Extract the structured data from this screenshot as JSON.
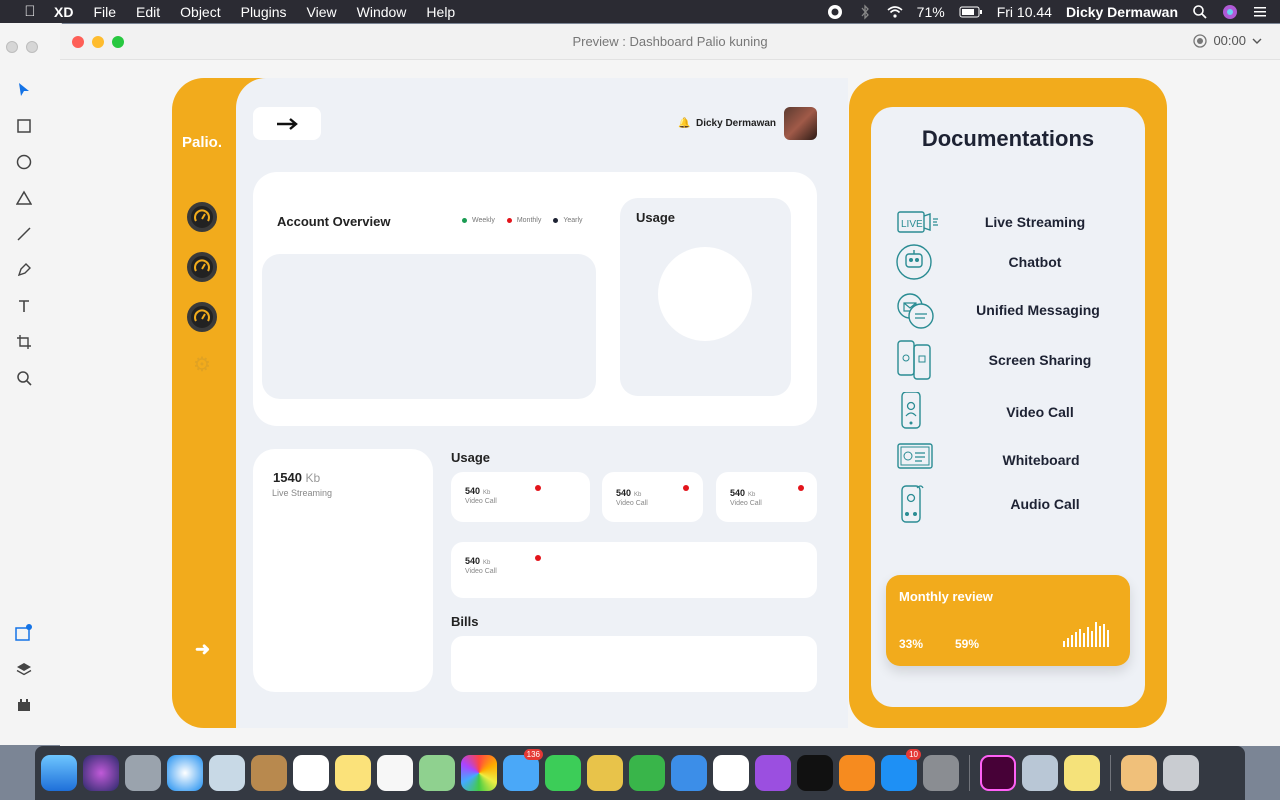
{
  "menubar": {
    "app_name": "XD",
    "menus": [
      "File",
      "Edit",
      "Object",
      "Plugins",
      "View",
      "Window",
      "Help"
    ],
    "battery": "71%",
    "clock": "Fri 10.44",
    "user": "Dicky Dermawan"
  },
  "window": {
    "title": "Preview : Dashboard Palio kuning",
    "timer": "00:00"
  },
  "dashboard": {
    "logo": "Palio.",
    "user_name": "Dicky Dermawan",
    "overview": {
      "title": "Account Overview",
      "legend": [
        {
          "label": "Weekly",
          "color": "#1a9b52"
        },
        {
          "label": "Monthly",
          "color": "#e3141b"
        },
        {
          "label": "Yearly",
          "color": "#1d2233"
        }
      ]
    },
    "usage_title": "Usage",
    "stream": {
      "value": "1540",
      "unit": "Kb",
      "label": "Live Streaming"
    },
    "usage_section": "Usage",
    "usage_cards": [
      {
        "value": "540",
        "unit": "Kb",
        "label": "Video Call"
      },
      {
        "value": "540",
        "unit": "Kb",
        "label": "Video Call"
      },
      {
        "value": "540",
        "unit": "Kb",
        "label": "Video Call"
      },
      {
        "value": "540",
        "unit": "Kb",
        "label": "Video Call"
      }
    ],
    "bills_title": "Bills"
  },
  "docs": {
    "title": "Documentations",
    "items": [
      {
        "label": "Live Streaming",
        "icon": "live-icon"
      },
      {
        "label": "Chatbot",
        "icon": "robot-icon"
      },
      {
        "label": "Unified Messaging",
        "icon": "messages-icon"
      },
      {
        "label": "Screen Sharing",
        "icon": "screen-share-icon"
      },
      {
        "label": "Video Call",
        "icon": "video-call-icon"
      },
      {
        "label": "Whiteboard",
        "icon": "whiteboard-icon"
      },
      {
        "label": "Audio Call",
        "icon": "audio-call-icon"
      }
    ],
    "review": {
      "title": "Monthly review",
      "pct1": "33%",
      "pct2": "59%"
    }
  },
  "dock_badges": {
    "messages": "136",
    "appstore": "10"
  }
}
